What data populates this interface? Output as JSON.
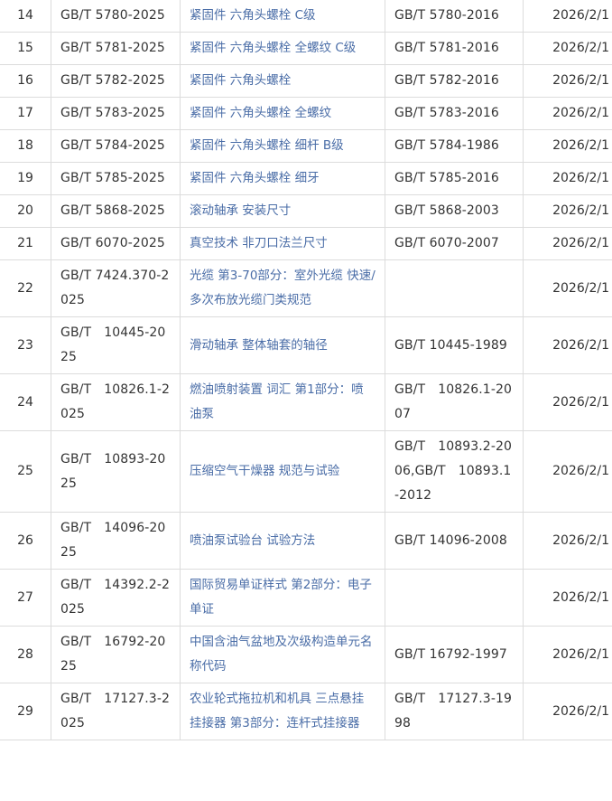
{
  "rows": [
    {
      "no": "14",
      "std": "GB/T 5780-2025",
      "name": "紧固件 六角头螺栓 C级",
      "replaces": "GB/T 5780-2016",
      "date": "2026/2/1"
    },
    {
      "no": "15",
      "std": "GB/T 5781-2025",
      "name": "紧固件 六角头螺栓 全螺纹 C级",
      "replaces": "GB/T 5781-2016",
      "date": "2026/2/1"
    },
    {
      "no": "16",
      "std": "GB/T 5782-2025",
      "name": "紧固件 六角头螺栓",
      "replaces": "GB/T 5782-2016",
      "date": "2026/2/1"
    },
    {
      "no": "17",
      "std": "GB/T 5783-2025",
      "name": "紧固件 六角头螺栓 全螺纹",
      "replaces": "GB/T 5783-2016",
      "date": "2026/2/1"
    },
    {
      "no": "18",
      "std": "GB/T 5784-2025",
      "name": "紧固件 六角头螺栓 细杆 B级",
      "replaces": "GB/T 5784-1986",
      "date": "2026/2/1"
    },
    {
      "no": "19",
      "std": "GB/T 5785-2025",
      "name": "紧固件 六角头螺栓 细牙",
      "replaces": "GB/T 5785-2016",
      "date": "2026/2/1"
    },
    {
      "no": "20",
      "std": "GB/T 5868-2025",
      "name": "滚动轴承 安装尺寸",
      "replaces": "GB/T 5868-2003",
      "date": "2026/2/1"
    },
    {
      "no": "21",
      "std": "GB/T 6070-2025",
      "name": "真空技术 非刀口法兰尺寸",
      "replaces": "GB/T 6070-2007",
      "date": "2026/2/1"
    },
    {
      "no": "22",
      "std": "GB/T 7424.370-2025",
      "name": "光缆 第3-70部分：室外光缆 快速/多次布放光缆门类规范",
      "replaces": "",
      "date": "2026/2/1"
    },
    {
      "no": "23",
      "std": "GB/T　10445-2025",
      "name": "滑动轴承 整体轴套的轴径",
      "replaces": "GB/T 10445-1989",
      "date": "2026/2/1"
    },
    {
      "no": "24",
      "std": "GB/T　10826.1-2025",
      "name": "燃油喷射装置 词汇 第1部分：喷油泵",
      "replaces": "GB/T　10826.1-2007",
      "date": "2026/2/1"
    },
    {
      "no": "25",
      "std": "GB/T　10893-2025",
      "name": "压缩空气干燥器 规范与试验",
      "replaces": "GB/T　10893.2-2006,GB/T　10893.1-2012",
      "date": "2026/2/1"
    },
    {
      "no": "26",
      "std": "GB/T　14096-2025",
      "name": "喷油泵试验台 试验方法",
      "replaces": "GB/T 14096-2008",
      "date": "2026/2/1"
    },
    {
      "no": "27",
      "std": "GB/T　14392.2-2025",
      "name": "国际贸易单证样式 第2部分：电子单证",
      "replaces": "",
      "date": "2026/2/1"
    },
    {
      "no": "28",
      "std": "GB/T　16792-2025",
      "name": "中国含油气盆地及次级构造单元名称代码",
      "replaces": "GB/T 16792-1997",
      "date": "2026/2/1"
    },
    {
      "no": "29",
      "std": "GB/T　17127.3-2025",
      "name": "农业轮式拖拉机和机具 三点悬挂挂接器 第3部分：连杆式挂接器",
      "replaces": "GB/T　17127.3-1998",
      "date": "2026/2/1"
    }
  ]
}
